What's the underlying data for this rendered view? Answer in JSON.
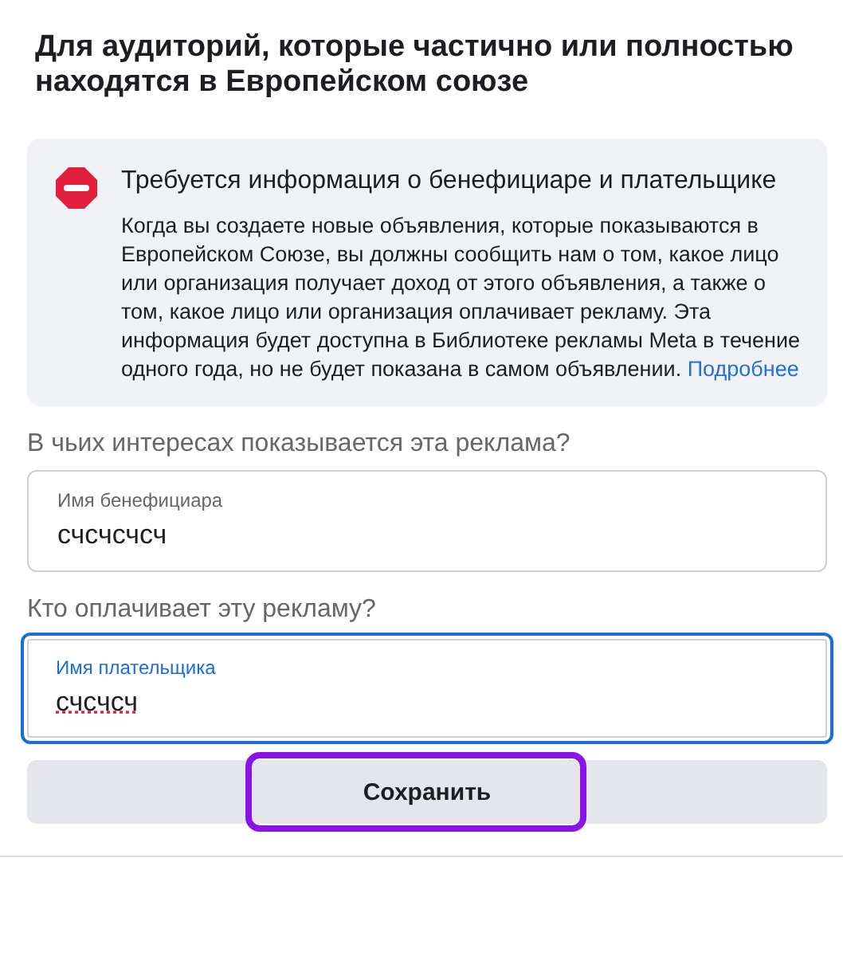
{
  "title": "Для аудиторий, которые частично или полностью находятся в Европейском союзе",
  "notice": {
    "kind": "error",
    "heading": "Требуется информация о бенефициаре и плательщике",
    "body": "Когда вы создаете новые объявления, которые показываются в Европейском Союзе, вы должны сообщить нам о том, какое лицо или организация получает доход от этого объявления, а также о том, какое лицо или организация оплачивает рекламу. Эта информация будет доступна в Библиотеке рекламы Meta в течение одного года, но не будет показана в самом объявлении.",
    "link": "Подробнее"
  },
  "fields": [
    {
      "question": "В чьих интересах показывается эта реклама?",
      "label": "Имя бенефициара",
      "value": "счсчсчсч",
      "focused": false,
      "misspelled": false
    },
    {
      "question": "Кто оплачивает эту рекламу?",
      "label": "Имя плательщика",
      "value": "счсчсч",
      "focused": true,
      "misspelled": true
    }
  ],
  "save_button": {
    "label": "Сохранить",
    "highlighted": true
  }
}
